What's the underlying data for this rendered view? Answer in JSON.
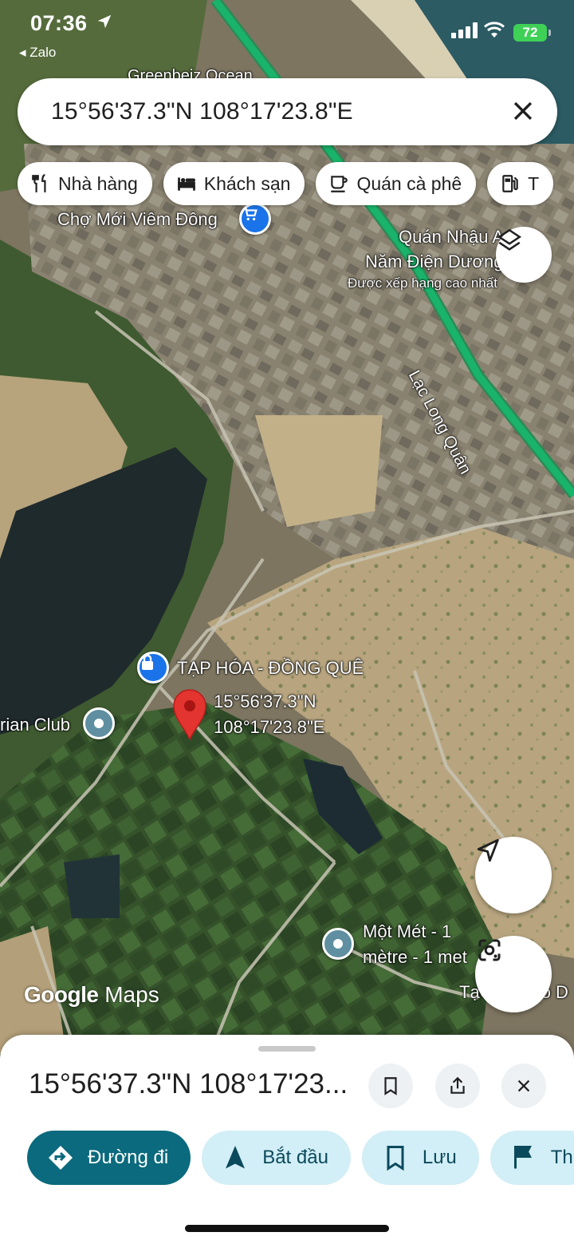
{
  "status_bar": {
    "time": "07:36",
    "back_app": "◂ Zalo",
    "battery": "72"
  },
  "search": {
    "query": "15°56'37.3\"N 108°17'23.8\"E"
  },
  "chips": [
    {
      "icon": "restaurant-icon",
      "label": "Nhà hàng"
    },
    {
      "icon": "hotel-icon",
      "label": "Khách sạn"
    },
    {
      "icon": "coffee-icon",
      "label": "Quán cà phê"
    },
    {
      "icon": "gas-station-icon",
      "label": "T"
    }
  ],
  "map": {
    "labels": {
      "market": "Chợ Mới Viêm Đông",
      "top_partial": "Greenbeiz Ocean",
      "bar_line1": "Quán Nhậu A",
      "bar_line2": "Năm Điện Dương",
      "bar_rating": "Được xếp hạng cao nhất",
      "road": "Lạc Long Quân",
      "grocery": "TẠP HÓA - ĐỒNG QUÊ",
      "pin_line1": "15°56'37.3\"N",
      "pin_line2": "108°17'23.8\"E",
      "club": "rian Club",
      "poi_line1": "Một Mét - 1",
      "poi_line2": "mètre - 1 met",
      "poi_bottom": "TạCh...emô D"
    },
    "watermark_google": "Google",
    "watermark_maps": "Maps",
    "colors": {
      "route": "#19b36b",
      "pin": "#e3342f",
      "poi": "#5f8fa0",
      "grocery": "#1a73e8"
    }
  },
  "sheet": {
    "title": "15°56'37.3\"N 108°17'23...",
    "actions": [
      {
        "icon": "directions-icon",
        "label": "Đường đi"
      },
      {
        "icon": "navigation-icon",
        "label": "Bắt đầu"
      },
      {
        "icon": "bookmark-icon",
        "label": "Lưu"
      },
      {
        "icon": "flag-icon",
        "label": "Th"
      }
    ]
  }
}
